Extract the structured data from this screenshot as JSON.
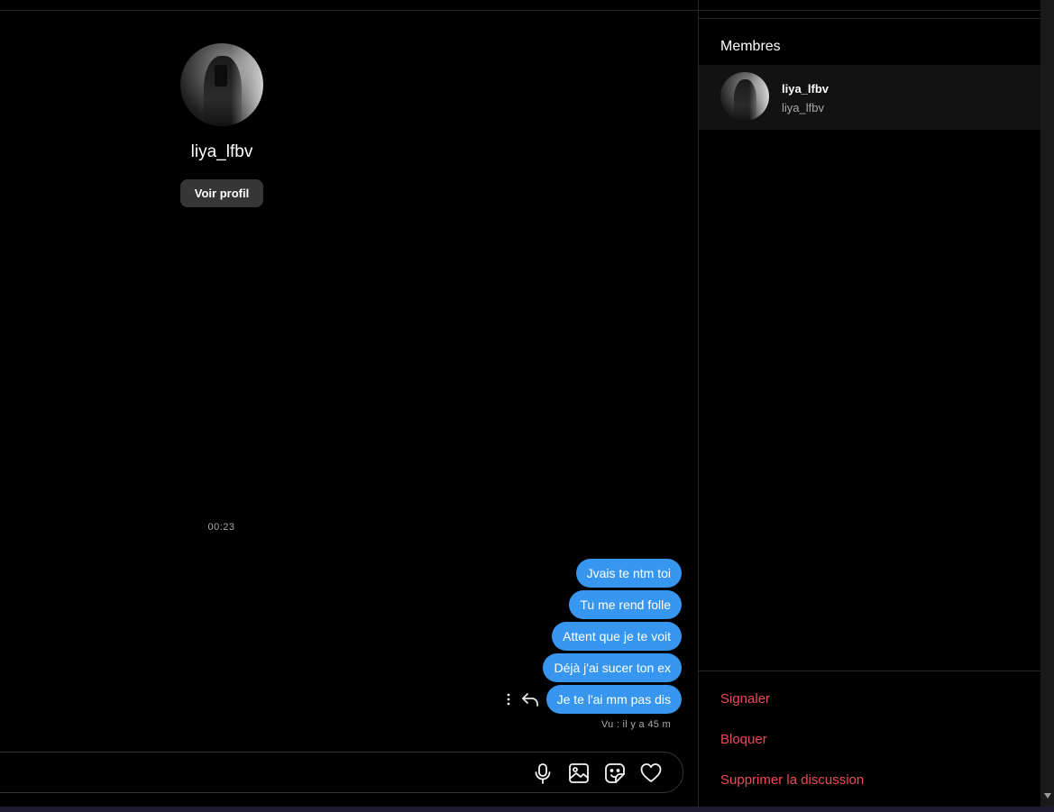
{
  "chat": {
    "profile_name": "liya_lfbv",
    "view_profile_label": "Voir profil",
    "timestamp": "00:23",
    "messages": [
      "Jvais te ntm toi",
      "Tu me rend folle",
      "Attent que je te voit",
      "Déjà j'ai sucer ton ex",
      "Je te l'ai mm pas dis"
    ],
    "seen_status": "Vu : il y a 45 m",
    "bubble_color": "#3797f0",
    "message_action_icons": [
      "more-options-icon",
      "reply-icon"
    ],
    "composer_icons": [
      "microphone-icon",
      "image-icon",
      "sticker-icon",
      "heart-icon"
    ]
  },
  "details": {
    "members_title": "Membres",
    "members": [
      {
        "name": "liya_lfbv",
        "username": "liya_lfbv"
      }
    ],
    "actions": {
      "report": "Signaler",
      "block": "Bloquer",
      "delete": "Supprimer la discussion"
    },
    "danger_color": "#ed4956"
  }
}
